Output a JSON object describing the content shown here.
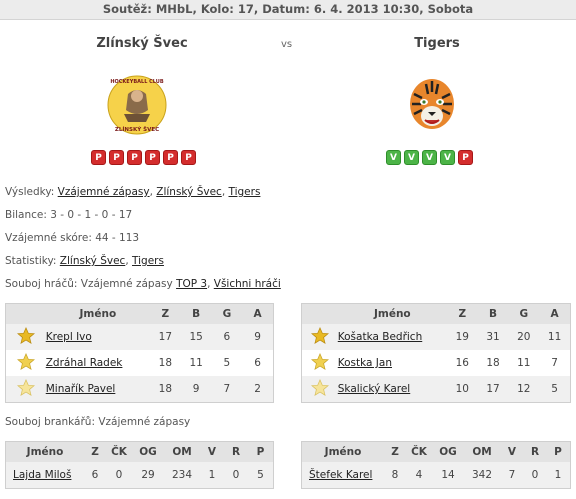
{
  "header": "Soutěž: MHbL, Kolo: 17, Datum: 6. 4. 2013 10:30, Sobota",
  "home_team": {
    "name": "Zlínský Švec",
    "form": [
      "P",
      "P",
      "P",
      "P",
      "P",
      "P"
    ],
    "logo_text_top": "HOCKEYBALL CLUB",
    "logo_text_bottom": "ZLÍNSKÝ ŠVEC"
  },
  "away_team": {
    "name": "Tigers",
    "form": [
      "V",
      "V",
      "V",
      "V",
      "P"
    ]
  },
  "vs": "vs",
  "info": {
    "results_label": "Výsledky:",
    "results_links": [
      "Vzájemné zápasy",
      "Zlínský Švec",
      "Tigers"
    ],
    "balance_label": "Bilance:",
    "balance_value": "3 - 0 - 1 - 0 - 17",
    "score_label": "Vzájemné skóre:",
    "score_value": "44 - 113",
    "stats_label": "Statistiky:",
    "stats_links": [
      "Zlínský Švec",
      "Tigers"
    ],
    "players_label": "Souboj hráčů: Vzájemné zápasy",
    "players_links": [
      "TOP 3",
      "Všichni hráči"
    ],
    "goalies_label": "Souboj brankářů: Vzájemné zápasy"
  },
  "player_columns": [
    "Jméno",
    "Z",
    "B",
    "G",
    "A"
  ],
  "home_players": [
    {
      "name": "Krepl Ivo",
      "z": "17",
      "b": "15",
      "g": "6",
      "a": "9",
      "star": "#e8b923"
    },
    {
      "name": "Zdráhal Radek",
      "z": "18",
      "b": "11",
      "g": "5",
      "a": "6",
      "star": "#f0d050"
    },
    {
      "name": "Minařík Pavel",
      "z": "18",
      "b": "9",
      "g": "7",
      "a": "2",
      "star": "#f6e49a"
    }
  ],
  "away_players": [
    {
      "name": "Košatka Bedřich",
      "z": "19",
      "b": "31",
      "g": "20",
      "a": "11",
      "star": "#e8b923"
    },
    {
      "name": "Kostka Jan",
      "z": "16",
      "b": "18",
      "g": "11",
      "a": "7",
      "star": "#f0d050"
    },
    {
      "name": "Skalický Karel",
      "z": "10",
      "b": "17",
      "g": "12",
      "a": "5",
      "star": "#f6e49a"
    }
  ],
  "goalie_columns": [
    "Jméno",
    "Z",
    "ČK",
    "OG",
    "OM",
    "V",
    "R",
    "P"
  ],
  "home_goalie": {
    "name": "Lajda Miloš",
    "z": "6",
    "ck": "0",
    "og": "29",
    "om": "234",
    "v": "1",
    "r": "0",
    "p": "5"
  },
  "away_goalie": {
    "name": "Štefek Karel",
    "z": "8",
    "ck": "4",
    "og": "14",
    "om": "342",
    "v": "7",
    "r": "0",
    "p": "1"
  }
}
